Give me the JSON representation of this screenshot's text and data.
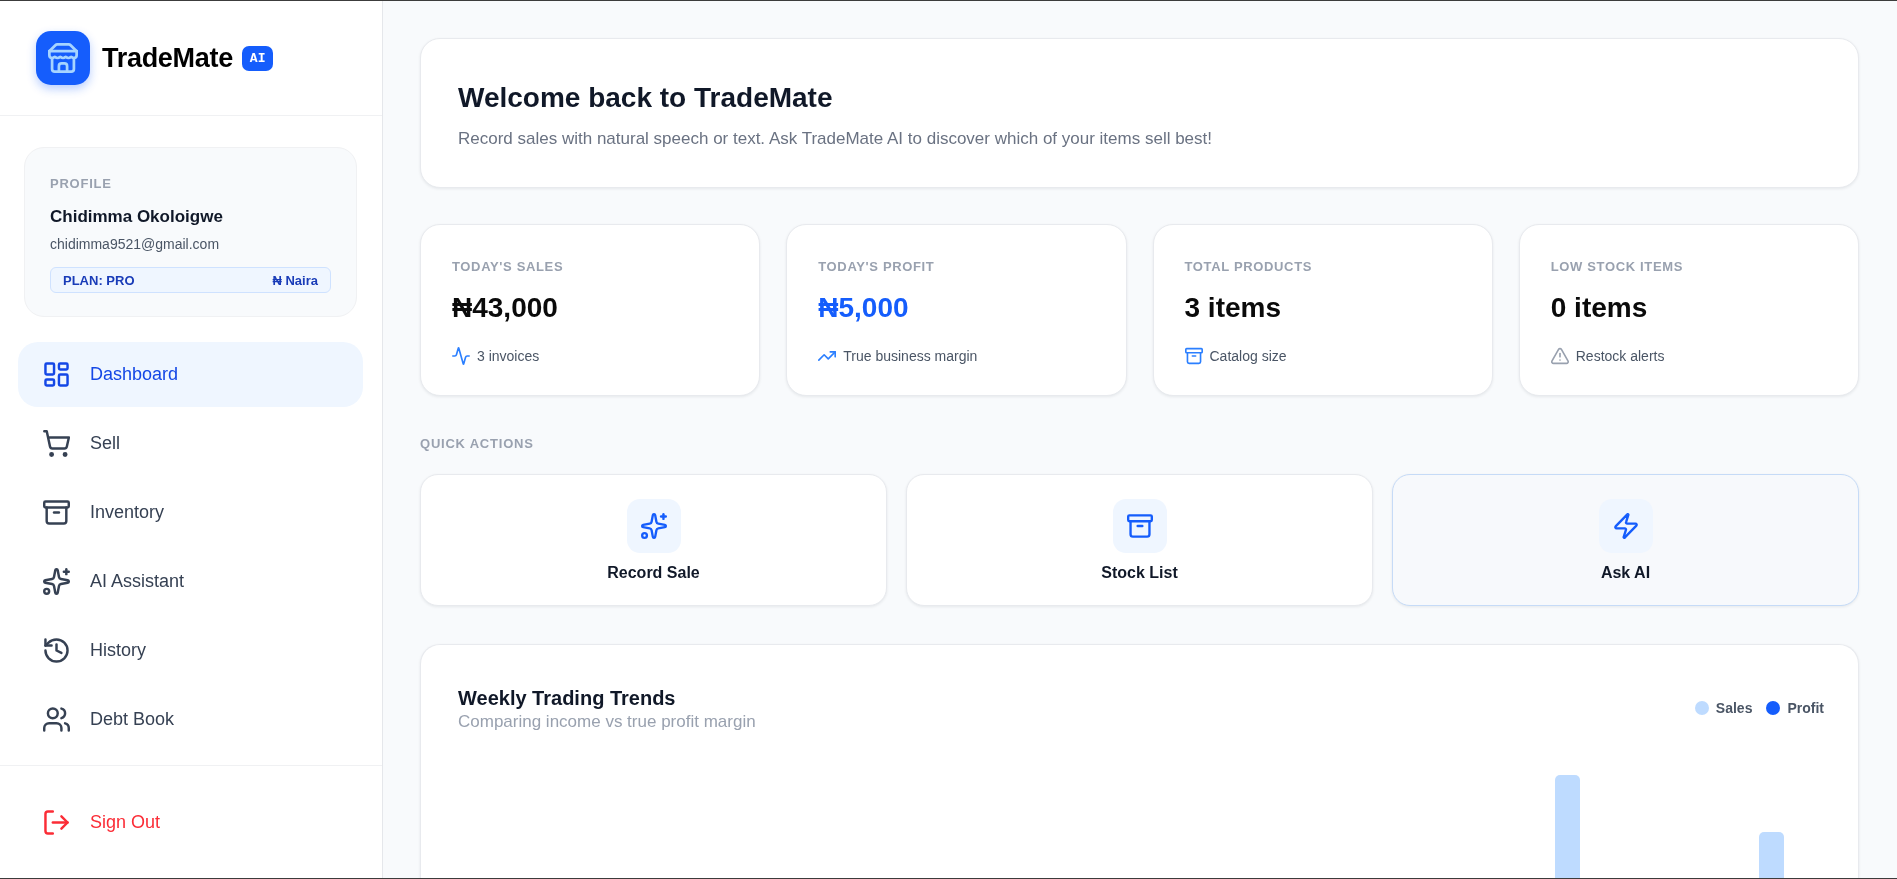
{
  "brand": {
    "name": "TradeMate",
    "badge": "AI"
  },
  "profile": {
    "heading": "PROFILE",
    "name": "Chidimma Okoloigwe",
    "email": "chidimma9521@gmail.com",
    "plan": "PLAN: PRO",
    "currency": "₦ Naira"
  },
  "nav": [
    {
      "label": "Dashboard",
      "selected": true
    },
    {
      "label": "Sell",
      "selected": false
    },
    {
      "label": "Inventory",
      "selected": false
    },
    {
      "label": "AI Assistant",
      "selected": false
    },
    {
      "label": "History",
      "selected": false
    },
    {
      "label": "Debt Book",
      "selected": false
    }
  ],
  "sign_out": {
    "label": "Sign Out"
  },
  "welcome": {
    "title": "Welcome back to TradeMate",
    "subtitle": "Record sales with natural speech or text. Ask TradeMate AI to discover which of your items sell best!"
  },
  "stats": [
    {
      "label": "TODAY'S SALES",
      "value": "₦43,000",
      "note": "3 invoices",
      "highlighted": false
    },
    {
      "label": "TODAY'S PROFIT",
      "value": "₦5,000",
      "note": "True business margin",
      "highlighted": true
    },
    {
      "label": "TOTAL PRODUCTS",
      "value": "3 items",
      "note": "Catalog size",
      "highlighted": false
    },
    {
      "label": "LOW STOCK ITEMS",
      "value": "0 items",
      "note": "Restock alerts",
      "highlighted": false
    }
  ],
  "quick_actions": {
    "heading": "QUICK ACTIONS",
    "items": [
      {
        "label": "Record Sale",
        "highlighted": false
      },
      {
        "label": "Stock List",
        "highlighted": false
      },
      {
        "label": "Ask AI",
        "highlighted": true
      }
    ]
  },
  "trends": {
    "title": "Weekly Trading Trends",
    "subtitle": "Comparing income vs true profit margin",
    "legend": [
      {
        "label": "Sales",
        "color": "#bedbff"
      },
      {
        "label": "Profit",
        "color": "#155dfc"
      }
    ]
  }
}
